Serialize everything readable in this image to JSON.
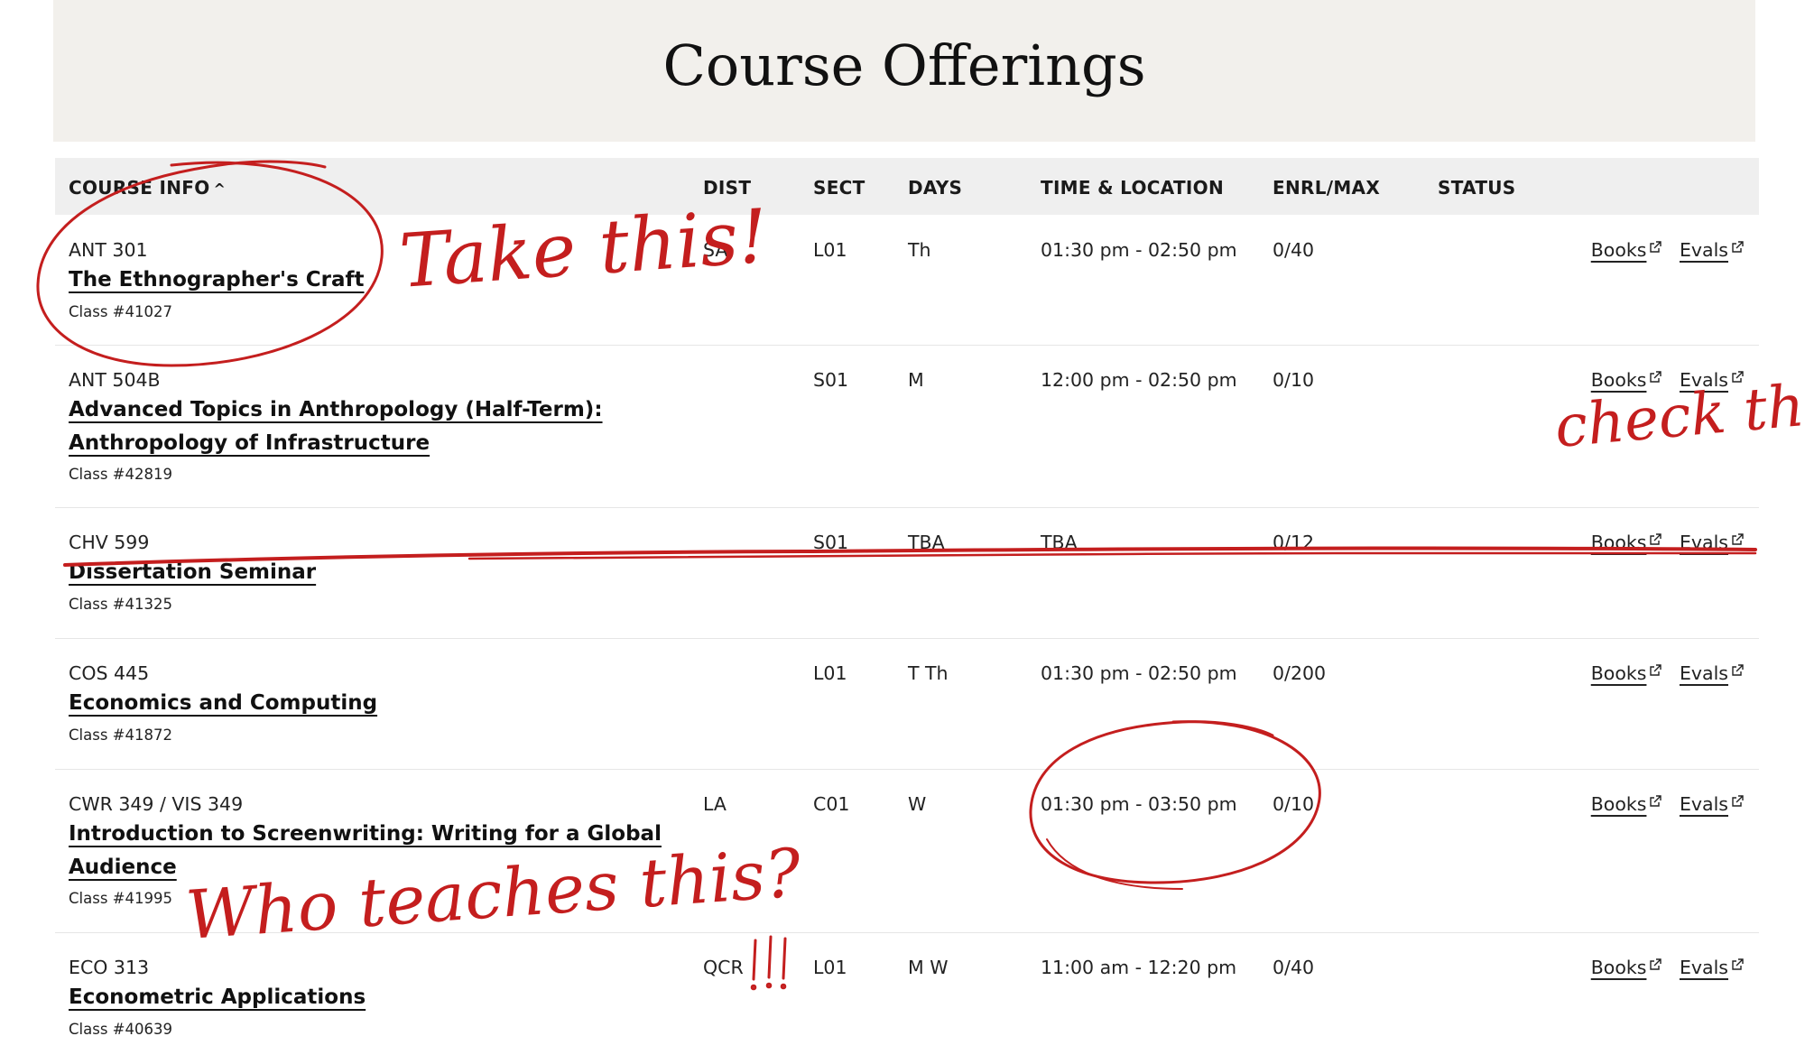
{
  "page": {
    "title": "Course Offerings"
  },
  "table": {
    "headers": {
      "course_info": "COURSE INFO",
      "dist": "DIST",
      "sect": "SECT",
      "days": "DAYS",
      "time_location": "TIME & LOCATION",
      "enrl_max": "ENRL/MAX",
      "status": "STATUS"
    },
    "sort_indicator": "^",
    "books_label": "Books",
    "evals_label": "Evals",
    "rows": [
      {
        "code": "ANT 301",
        "title": "The Ethnographer's Craft",
        "title_line2": "",
        "class_no": "Class #41027",
        "dist": "SA",
        "sect": "L01",
        "days": "Th",
        "time": "01:30 pm - 02:50 pm",
        "enrl": "0/40",
        "status": ""
      },
      {
        "code": "ANT 504B",
        "title": "Advanced Topics in Anthropology (Half-Term):",
        "title_line2": "Anthropology of Infrastructure",
        "class_no": "Class #42819",
        "dist": "",
        "sect": "S01",
        "days": "M",
        "time": "12:00 pm - 02:50 pm",
        "enrl": "0/10",
        "status": ""
      },
      {
        "code": "CHV 599",
        "title": "Dissertation Seminar",
        "title_line2": "",
        "class_no": "Class #41325",
        "dist": "",
        "sect": "S01",
        "days": "TBA",
        "time": "TBA",
        "enrl": "0/12",
        "status": ""
      },
      {
        "code": "COS 445",
        "title": "Economics and Computing",
        "title_line2": "",
        "class_no": "Class #41872",
        "dist": "",
        "sect": "L01",
        "days": "T Th",
        "time": "01:30 pm - 02:50 pm",
        "enrl": "0/200",
        "status": ""
      },
      {
        "code": "CWR 349 / VIS 349",
        "title": "Introduction to Screenwriting: Writing for a Global",
        "title_line2": "Audience",
        "class_no": "Class #41995",
        "dist": "LA",
        "sect": "C01",
        "days": "W",
        "time": "01:30 pm - 03:50 pm",
        "enrl": "0/10",
        "status": ""
      },
      {
        "code": "ECO 313",
        "title": "Econometric Applications",
        "title_line2": "",
        "class_no": "Class #40639",
        "dist": "QCR",
        "sect": "L01",
        "days": "M W",
        "time": "11:00 am - 12:20 pm",
        "enrl": "0/40",
        "status": ""
      }
    ]
  },
  "annotations": {
    "note_take": "Take this!",
    "note_check": "check these",
    "note_who": "Who teaches this?",
    "note_marks": "!!!",
    "ink_color": "#c41e1e"
  }
}
